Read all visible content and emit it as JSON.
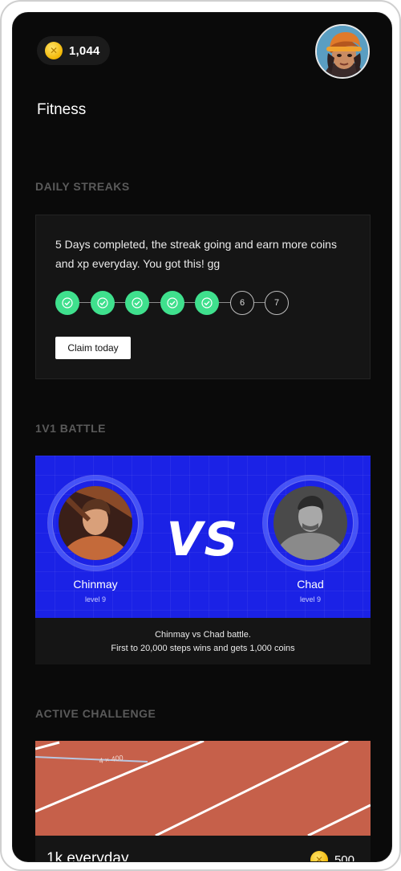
{
  "header": {
    "coins": "1,044",
    "coin_icon": "coin-icon",
    "avatar_icon": "profile-avatar"
  },
  "page_title": "Fitness",
  "daily_streaks": {
    "heading": "DAILY STREAKS",
    "message": "5 Days completed, the streak going and earn more coins and xp everyday. You got this! gg",
    "days": [
      {
        "label": "",
        "done": true
      },
      {
        "label": "",
        "done": true
      },
      {
        "label": "",
        "done": true
      },
      {
        "label": "",
        "done": true
      },
      {
        "label": "",
        "done": true
      },
      {
        "label": "6",
        "done": false
      },
      {
        "label": "7",
        "done": false
      }
    ],
    "completed_days": 5,
    "claim_label": "Claim today",
    "accent_color": "#3fe08d"
  },
  "battle": {
    "heading": "1V1 BATTLE",
    "vs_label": "VS",
    "banner_color": "#1b22e6",
    "player1": {
      "name": "Chinmay",
      "level": "level 9"
    },
    "player2": {
      "name": "Chad",
      "level": "level 9"
    },
    "desc_line1": "Chinmay vs Chad battle.",
    "desc_line2": "First to 20,000 steps wins and gets 1,000 coins"
  },
  "active_challenge": {
    "heading": "ACTIVE CHALLENGE",
    "name": "1k everyday",
    "reward": "500"
  }
}
